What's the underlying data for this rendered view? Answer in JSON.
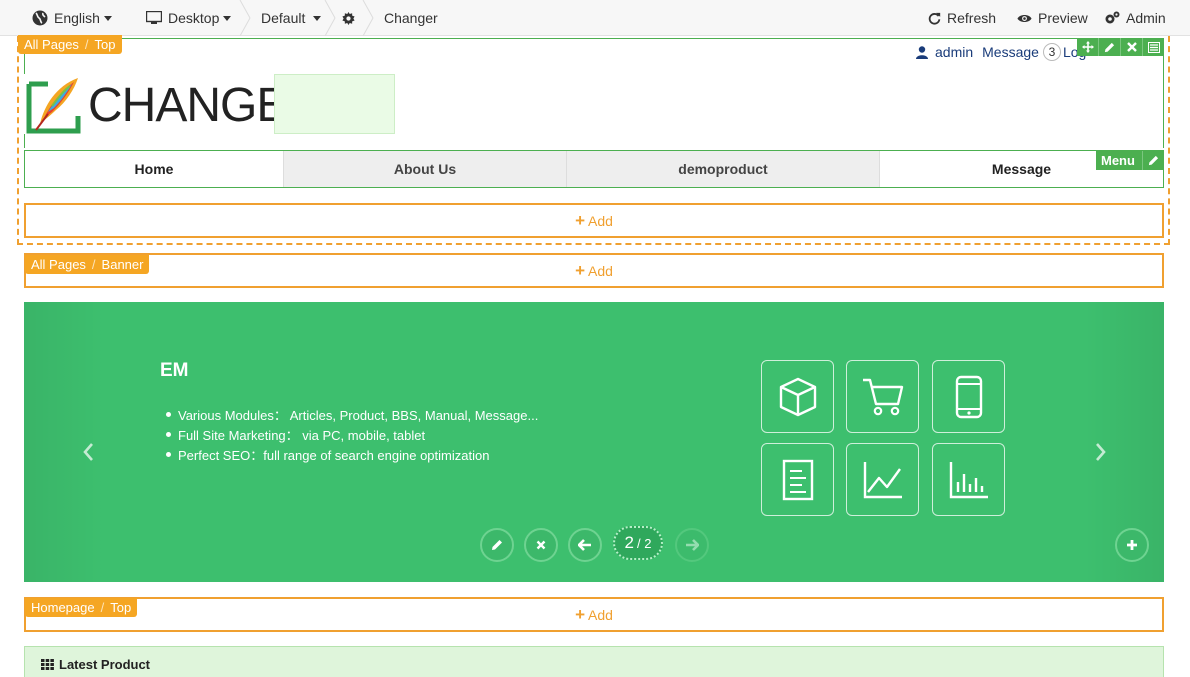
{
  "toolbar": {
    "language": "English",
    "device": "Desktop",
    "theme": "Default",
    "page": "Changer",
    "refresh": "Refresh",
    "preview": "Preview",
    "admin": "Admin"
  },
  "top_section": {
    "tag_scope": "All Pages",
    "tag_position": "Top"
  },
  "header": {
    "user": "admin",
    "message_label": "Message",
    "message_count": "3",
    "logout": "Log",
    "logo_text": "CHANGER"
  },
  "menu": {
    "items": [
      "Home",
      "About Us",
      "demoproduct",
      "Message"
    ],
    "tag": "Menu"
  },
  "add_label": "Add",
  "banner_section": {
    "tag_scope": "All Pages",
    "tag_position": "Banner"
  },
  "banner": {
    "title": "EM",
    "bullets": [
      "Various Modules： Articles, Product, BBS, Manual, Message...",
      "Full Site Marketing： via PC, mobile, tablet",
      "Perfect SEO：full range of search engine optimization"
    ],
    "page_current": "2",
    "page_total": "/ 2",
    "icons": [
      "box-icon",
      "cart-icon",
      "mobile-icon",
      "document-icon",
      "line-chart-icon",
      "bar-chart-icon"
    ]
  },
  "homepage_section": {
    "tag_scope": "Homepage",
    "tag_position": "Top"
  },
  "latest": {
    "title": "Latest Product"
  },
  "colors": {
    "accent_orange": "#f0a030",
    "green": "#4caf50",
    "banner_green": "#3dbf6e",
    "link_blue": "#1a3c7a"
  }
}
